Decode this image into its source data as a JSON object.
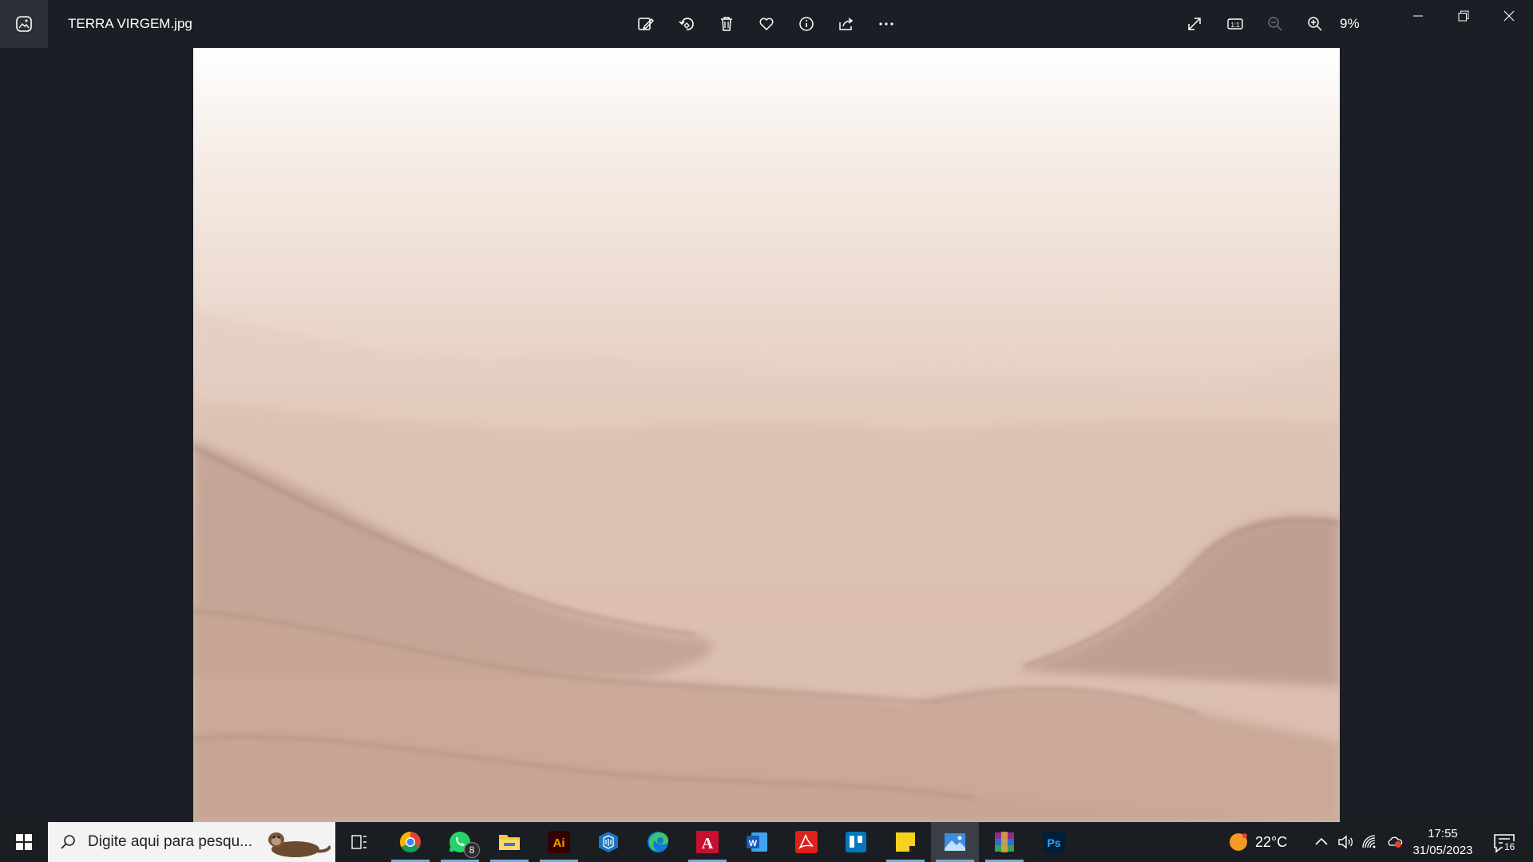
{
  "window": {
    "title": "TERRA VIRGEM.jpg",
    "zoom_level": "9%",
    "toolbar_actions": [
      "edit-image",
      "rotate",
      "delete",
      "favorite",
      "file-info",
      "share",
      "see-more"
    ],
    "view_actions": [
      "full-screen",
      "actual-size",
      "zoom-out",
      "zoom-in"
    ],
    "window_controls": [
      "minimize",
      "restore",
      "close"
    ]
  },
  "image": {
    "description_colors": {
      "sky": "#f8f1ec",
      "haze": "#e3cbbc",
      "ridge": "#b3907f",
      "ground": "#cba898"
    }
  },
  "taskbar": {
    "search_placeholder": "Digite aqui para pesqu...",
    "apps": [
      {
        "name": "task-view"
      },
      {
        "name": "chrome"
      },
      {
        "name": "whatsapp",
        "badge": "8"
      },
      {
        "name": "file-explorer"
      },
      {
        "name": "adobe-illustrator",
        "label": "Ai"
      },
      {
        "name": "sketchup"
      },
      {
        "name": "edge"
      },
      {
        "name": "autocad",
        "label": "A"
      },
      {
        "name": "word",
        "label": "W"
      },
      {
        "name": "acrobat"
      },
      {
        "name": "trello"
      },
      {
        "name": "sticky-notes"
      },
      {
        "name": "photos"
      },
      {
        "name": "winrar"
      },
      {
        "name": "photoshop",
        "label": "Ps"
      }
    ],
    "weather_temp": "22°C",
    "time": "17:55",
    "date": "31/05/2023",
    "notification_count": "16"
  },
  "colors": {
    "titlebar_bg": "#1b1f25",
    "taskbar_bg": "#1a1d22",
    "accent_underline": "#7aa9d4"
  }
}
